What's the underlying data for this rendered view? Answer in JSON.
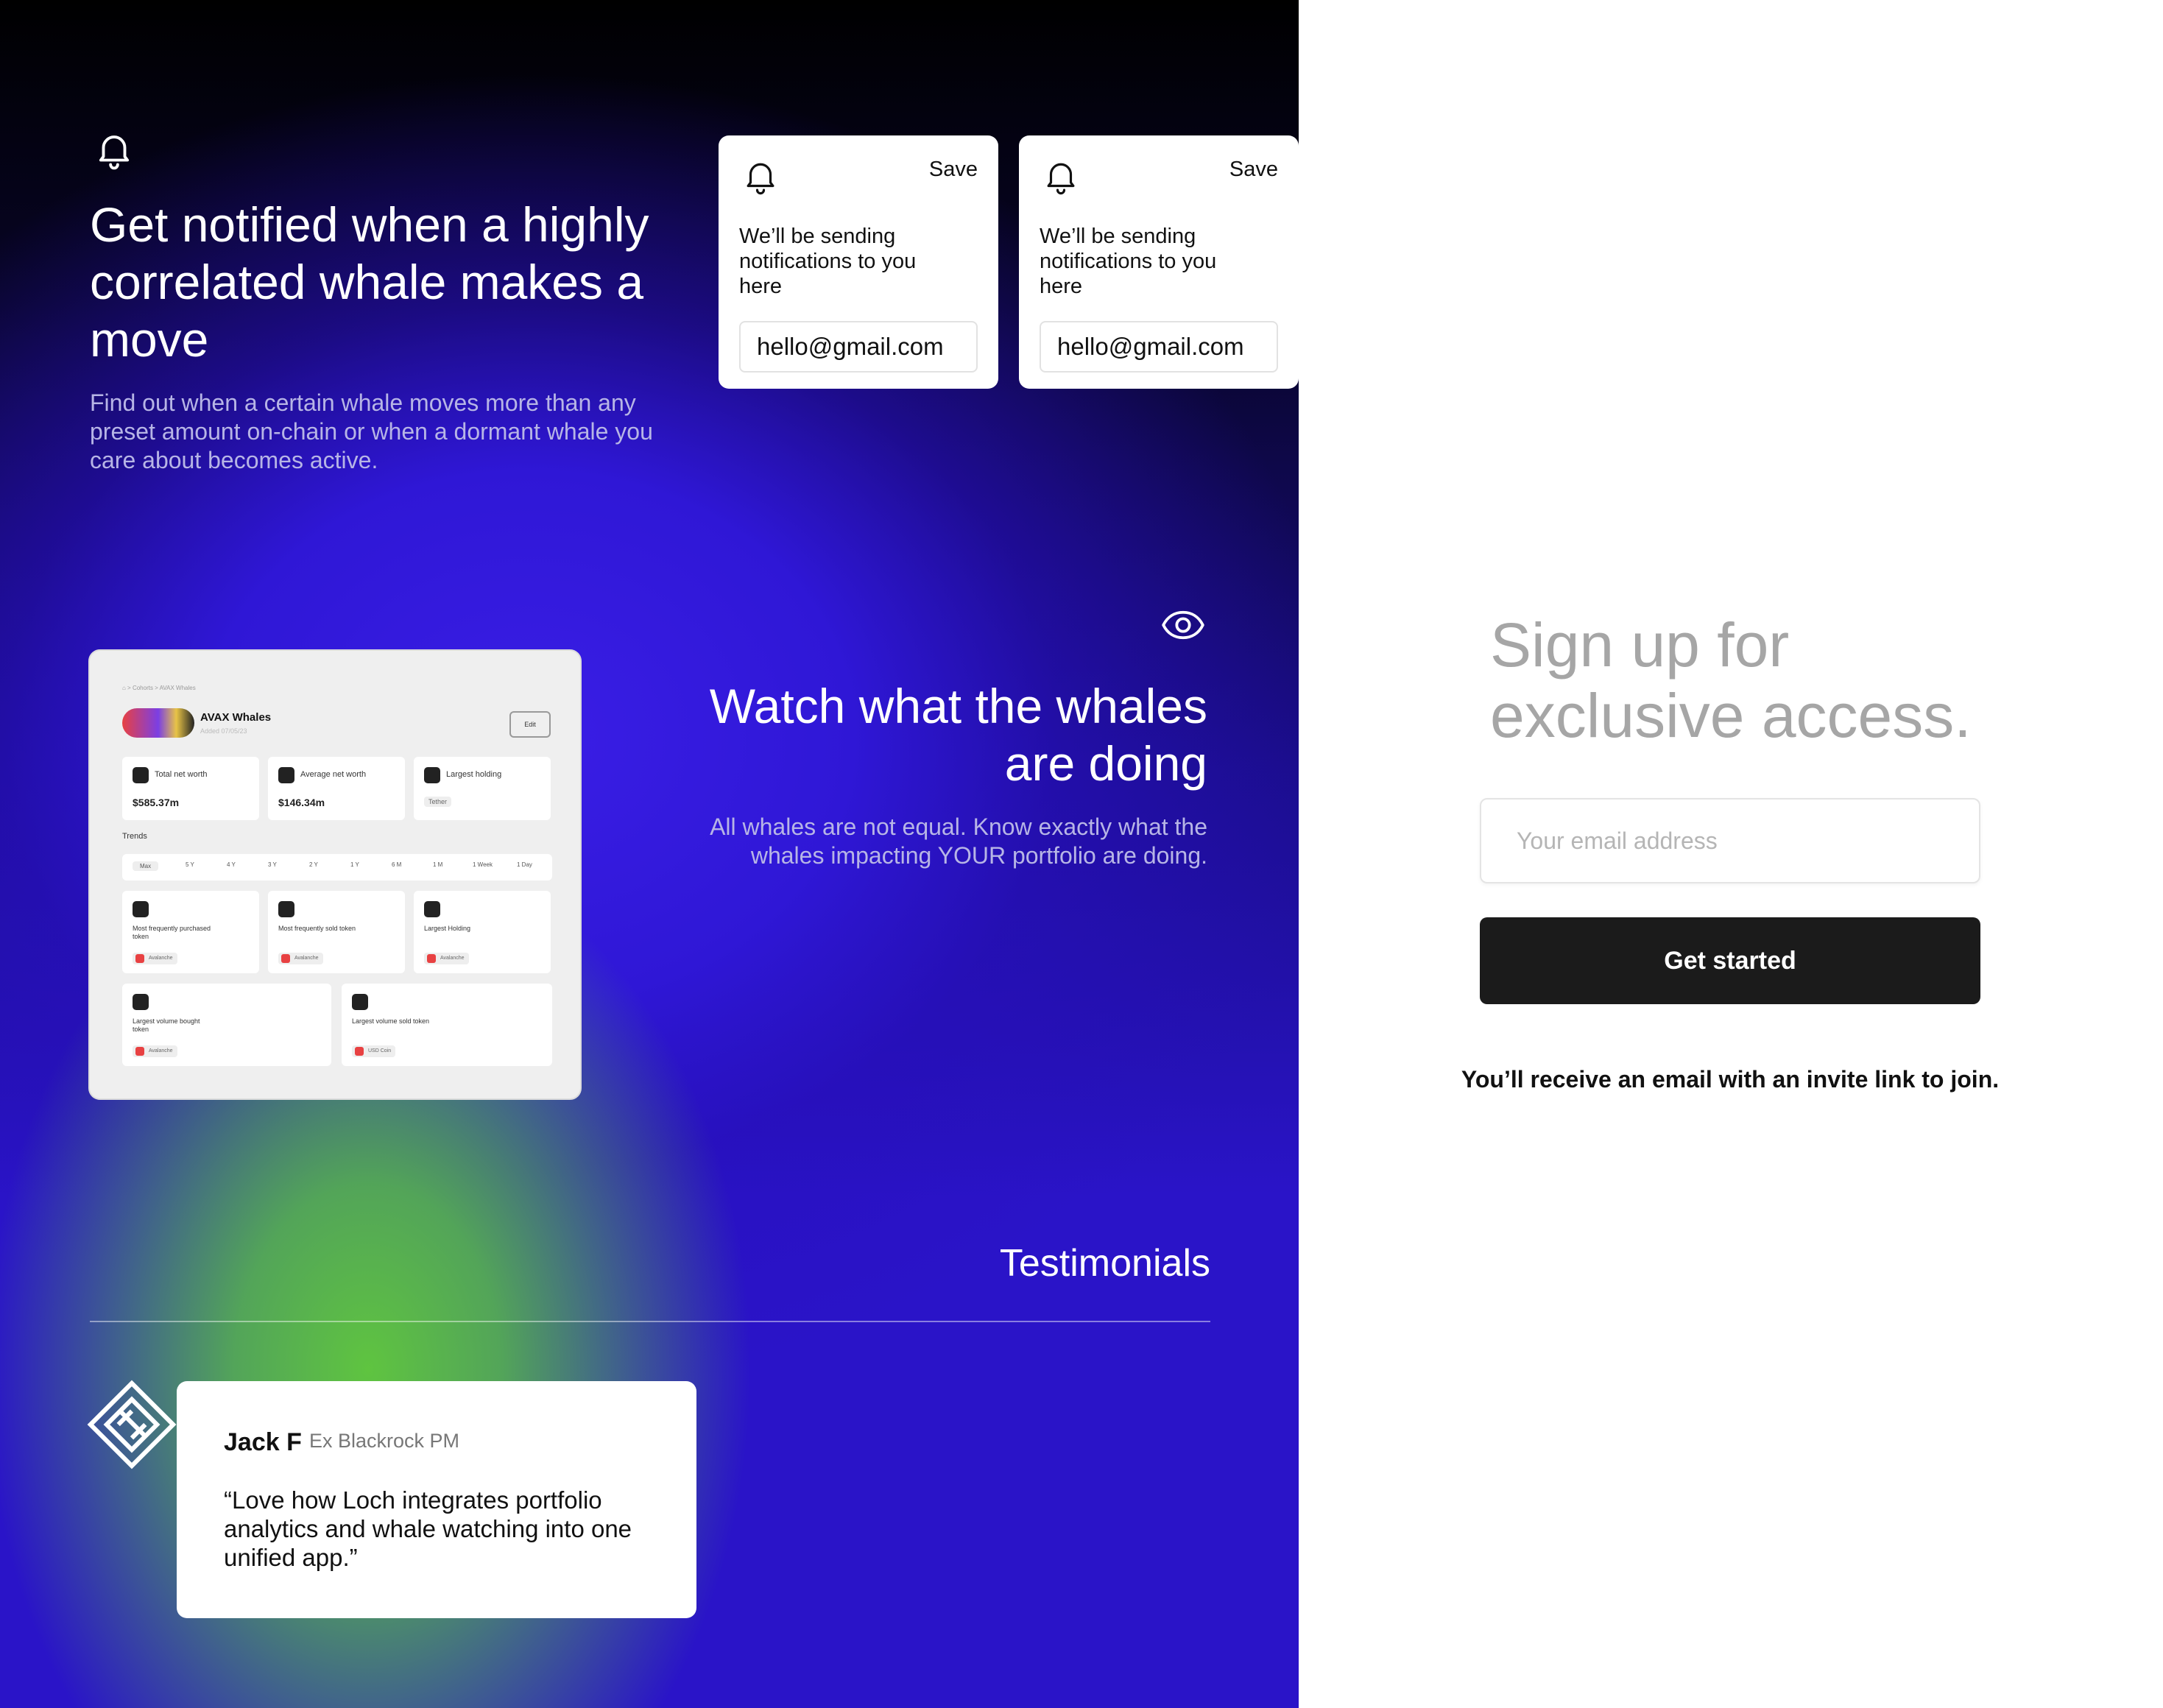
{
  "notify": {
    "heading": "Get notified when a highly correlated whale makes a move",
    "body": "Find out when a certain whale moves more than any preset amount on-chain or when a dormant whale you care about becomes active.",
    "cards": [
      {
        "save": "Save",
        "message": "We’ll be sending notifications to you here",
        "email": "hello@gmail.com"
      },
      {
        "save": "Save",
        "message": "We’ll be sending notifications to you here",
        "email": "hello@gmail.com"
      }
    ]
  },
  "watch": {
    "heading": "Watch what the whales are doing",
    "body": "All whales are not equal. Know exactly what the whales impacting YOUR portfolio are doing."
  },
  "dashboard": {
    "breadcrumb": "⌂  >  Cohorts  >  AVAX Whales",
    "title": "AVAX Whales",
    "added": "Added 07/05/23",
    "edit": "Edit",
    "stats": [
      {
        "label": "Total net worth",
        "value": "$585.37m"
      },
      {
        "label": "Average net worth",
        "value": "$146.34m"
      },
      {
        "label": "Largest holding",
        "value": "Tether"
      }
    ],
    "trends_label": "Trends",
    "ranges": [
      "Max",
      "5 Y",
      "4 Y",
      "3 Y",
      "2 Y",
      "1 Y",
      "6 M",
      "1 M",
      "1 Week",
      "1 Day"
    ],
    "tiles": [
      {
        "label": "Most frequently purchased token",
        "chip": "Avalanche"
      },
      {
        "label": "Most frequently sold token",
        "chip": "Avalanche"
      },
      {
        "label": "Largest Holding",
        "chip": "Avalanche"
      },
      {
        "label": "Largest volume bought token",
        "chip": "Avalanche"
      },
      {
        "label": "Largest volume sold token",
        "chip": "USD Coin"
      }
    ]
  },
  "testimonials": {
    "heading": "Testimonials",
    "items": [
      {
        "name": "Jack F",
        "role": "Ex Blackrock PM",
        "quote": "“Love how Loch integrates portfolio analytics and whale watching into one unified app.”"
      }
    ]
  },
  "signup": {
    "heading": "Sign up for exclusive access.",
    "email_placeholder": "Your email address",
    "button": "Get started",
    "note": "You’ll receive an email with an invite link to join."
  }
}
